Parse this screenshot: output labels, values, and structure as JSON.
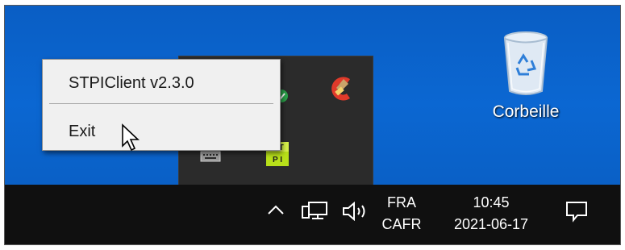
{
  "context_menu": {
    "items": [
      {
        "label": "STPIClient v2.3.0"
      },
      {
        "label": "Exit"
      }
    ]
  },
  "desktop": {
    "recycle_bin_label": "Corbeille"
  },
  "taskbar": {
    "language_top": "FRA",
    "language_bottom": "CAFR",
    "time": "10:45",
    "date": "2021-06-17"
  },
  "tray_overflow": {
    "icons": [
      "network-adapter-icon",
      "shield-check-icon",
      "ccleaner-icon",
      "keyboard-icon",
      "stpi-client-icon"
    ]
  },
  "colors": {
    "desktop_blue": "#0a63c9",
    "taskbar": "#101010",
    "overflow_panel": "#2b2b2b",
    "menu_bg": "#f0f0f0"
  }
}
